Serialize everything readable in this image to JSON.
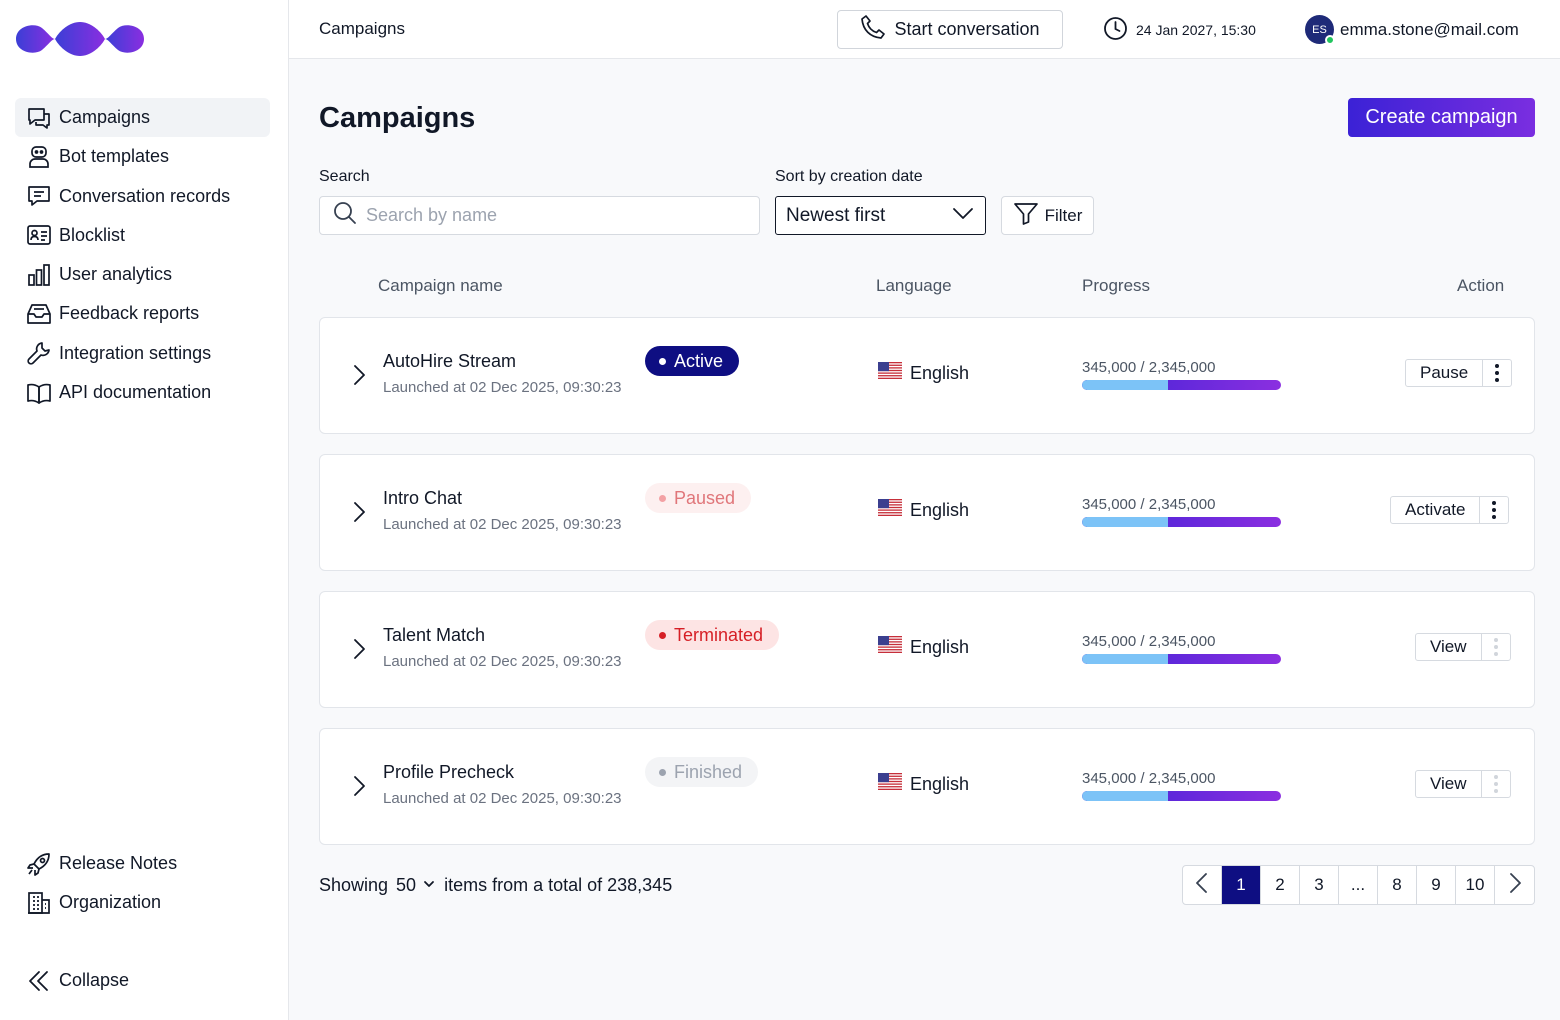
{
  "sidebar": {
    "items": [
      {
        "label": "Campaigns",
        "icon": "chat-bubbles-icon",
        "active": true
      },
      {
        "label": "Bot templates",
        "icon": "robot-icon"
      },
      {
        "label": "Conversation records",
        "icon": "message-icon"
      },
      {
        "label": "Blocklist",
        "icon": "id-card-icon"
      },
      {
        "label": "User analytics",
        "icon": "bar-chart-icon"
      },
      {
        "label": "Feedback reports",
        "icon": "inbox-icon"
      },
      {
        "label": "Integration settings",
        "icon": "wrench-icon"
      },
      {
        "label": "API documentation",
        "icon": "book-icon"
      }
    ],
    "bottom": [
      {
        "label": "Release Notes",
        "icon": "rocket-icon"
      },
      {
        "label": "Organization",
        "icon": "building-icon"
      }
    ],
    "collapse_label": "Collapse"
  },
  "topbar": {
    "breadcrumb": "Campaigns",
    "start_label": "Start conversation",
    "datetime": "24 Jan 2027, 15:30",
    "avatar_initials": "ES",
    "email": "emma.stone@mail.com"
  },
  "page": {
    "title": "Campaigns",
    "create_label": "Create campaign",
    "search_label": "Search",
    "search_placeholder": "Search by name",
    "sort_label": "Sort by creation date",
    "sort_value": "Newest first",
    "filter_label": "Filter"
  },
  "table": {
    "headers": [
      "Campaign name",
      "Language",
      "Progress",
      "Action"
    ],
    "rows": [
      {
        "name": "AutoHire Stream",
        "launched": "Launched at 02 Dec 2025, 09:30:23",
        "status": "Active",
        "status_key": "active",
        "language": "English",
        "progress_text": "345,000 /  2,345,000",
        "progress_fraction": 0.43,
        "action": "Pause"
      },
      {
        "name": "Intro Chat",
        "launched": "Launched at 02 Dec 2025, 09:30:23",
        "status": "Paused",
        "status_key": "paused",
        "language": "English",
        "progress_text": "345,000 /  2,345,000",
        "progress_fraction": 0.43,
        "action": "Activate"
      },
      {
        "name": "Talent Match",
        "launched": "Launched at 02 Dec 2025, 09:30:23",
        "status": "Terminated",
        "status_key": "terminated",
        "language": "English",
        "progress_text": "345,000 /  2,345,000",
        "progress_fraction": 0.43,
        "action": "View"
      },
      {
        "name": "Profile Precheck",
        "launched": "Launched at 02 Dec 2025, 09:30:23",
        "status": "Finished",
        "status_key": "finished",
        "language": "English",
        "progress_text": "345,000 /  2,345,000",
        "progress_fraction": 0.43,
        "action": "View"
      }
    ]
  },
  "footer": {
    "showing_prefix": "Showing",
    "page_size": "50",
    "showing_suffix": "items from a total of 238,345",
    "pages": [
      "1",
      "2",
      "3",
      "...",
      "8",
      "9",
      "10"
    ],
    "current_page": "1"
  },
  "colors": {
    "accent_start": "#3b22d6",
    "accent_end": "#7a2ee0",
    "active_badge": "#0e0e82"
  }
}
